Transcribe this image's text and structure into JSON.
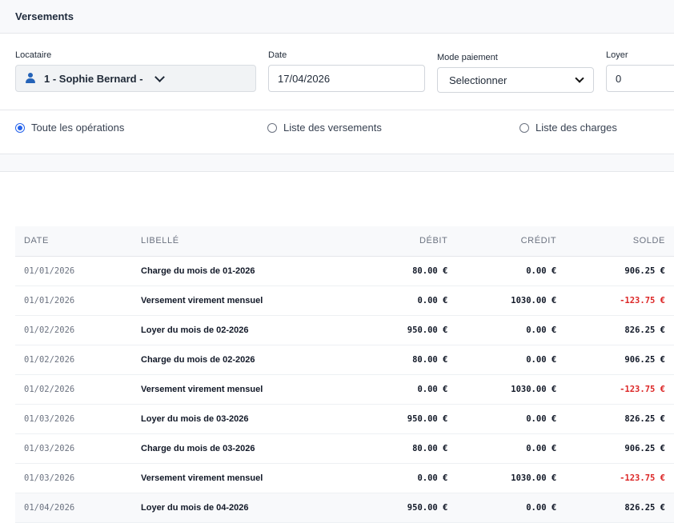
{
  "header": {
    "title": "Versements"
  },
  "form": {
    "locataire": {
      "label": "Locataire",
      "value": "1 - Sophie Bernard -",
      "icon": "user-icon"
    },
    "date": {
      "label": "Date",
      "value": "17/04/2026"
    },
    "mode": {
      "label": "Mode paiement",
      "value": "Selectionner"
    },
    "loyer": {
      "label": "Loyer",
      "value": "0"
    }
  },
  "filters": [
    {
      "label": "Toute les opérations",
      "selected": true
    },
    {
      "label": "Liste des versements",
      "selected": false
    },
    {
      "label": "Liste des charges",
      "selected": false
    }
  ],
  "table": {
    "columns": [
      "DATE",
      "LIBELLÉ",
      "DÉBIT",
      "CRÉDIT",
      "SOLDE"
    ],
    "rows": [
      {
        "date": "01/01/2026",
        "libelle": "Charge du mois de 01-2026",
        "debit": "80.00 €",
        "credit": "0.00 €",
        "solde": "906.25 €"
      },
      {
        "date": "01/01/2026",
        "libelle": "Versement virement mensuel",
        "debit": "0.00 €",
        "credit": "1030.00 €",
        "solde": "-123.75 €"
      },
      {
        "date": "01/02/2026",
        "libelle": "Loyer du mois de 02-2026",
        "debit": "950.00 €",
        "credit": "0.00 €",
        "solde": "826.25 €"
      },
      {
        "date": "01/02/2026",
        "libelle": "Charge du mois de 02-2026",
        "debit": "80.00 €",
        "credit": "0.00 €",
        "solde": "906.25 €"
      },
      {
        "date": "01/02/2026",
        "libelle": "Versement virement mensuel",
        "debit": "0.00 €",
        "credit": "1030.00 €",
        "solde": "-123.75 €"
      },
      {
        "date": "01/03/2026",
        "libelle": "Loyer du mois de 03-2026",
        "debit": "950.00 €",
        "credit": "0.00 €",
        "solde": "826.25 €"
      },
      {
        "date": "01/03/2026",
        "libelle": "Charge du mois de 03-2026",
        "debit": "80.00 €",
        "credit": "0.00 €",
        "solde": "906.25 €"
      },
      {
        "date": "01/03/2026",
        "libelle": "Versement virement mensuel",
        "debit": "0.00 €",
        "credit": "1030.00 €",
        "solde": "-123.75 €"
      },
      {
        "date": "01/04/2026",
        "libelle": "Loyer du mois de 04-2026",
        "debit": "950.00 €",
        "credit": "0.00 €",
        "solde": "826.25 €"
      }
    ]
  },
  "colors": {
    "accent": "#2563eb",
    "negative": "#dc2626",
    "header_bg": "#f8f9fb"
  }
}
